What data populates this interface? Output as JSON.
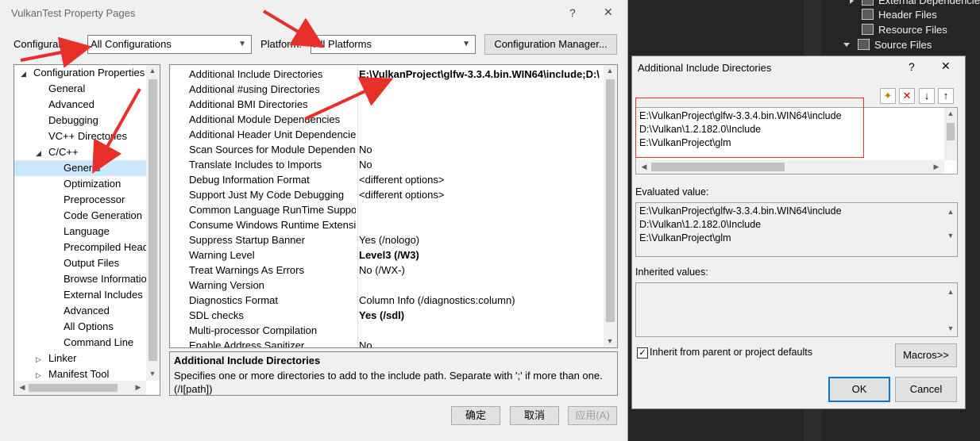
{
  "solution_explorer": {
    "items": [
      {
        "label": "External Dependencies"
      },
      {
        "label": "Header Files"
      },
      {
        "label": "Resource Files"
      },
      {
        "label": "Source Files"
      }
    ]
  },
  "dialog": {
    "title": "VulkanTest Property Pages",
    "help": "?",
    "close": "✕",
    "config_label": "Configuration:",
    "config_value": "All Configurations",
    "platform_label": "Platform:",
    "platform_value": "All Platforms",
    "config_manager": "Configuration Manager...",
    "tree": [
      {
        "label": "Configuration Properties",
        "exp": "open",
        "indent": 0
      },
      {
        "label": "General",
        "indent": 1
      },
      {
        "label": "Advanced",
        "indent": 1
      },
      {
        "label": "Debugging",
        "indent": 1
      },
      {
        "label": "VC++ Directories",
        "indent": 1
      },
      {
        "label": "C/C++",
        "exp": "open",
        "indent": 1
      },
      {
        "label": "General",
        "indent": 2,
        "selected": true
      },
      {
        "label": "Optimization",
        "indent": 2
      },
      {
        "label": "Preprocessor",
        "indent": 2
      },
      {
        "label": "Code Generation",
        "indent": 2
      },
      {
        "label": "Language",
        "indent": 2
      },
      {
        "label": "Precompiled Heade",
        "indent": 2
      },
      {
        "label": "Output Files",
        "indent": 2
      },
      {
        "label": "Browse Informatio",
        "indent": 2
      },
      {
        "label": "External Includes",
        "indent": 2
      },
      {
        "label": "Advanced",
        "indent": 2
      },
      {
        "label": "All Options",
        "indent": 2
      },
      {
        "label": "Command Line",
        "indent": 2
      },
      {
        "label": "Linker",
        "exp": "closed",
        "indent": 1
      },
      {
        "label": "Manifest Tool",
        "exp": "closed",
        "indent": 1
      }
    ],
    "props": [
      {
        "name": "Additional Include Directories",
        "value": "E:\\VulkanProject\\glfw-3.3.4.bin.WIN64\\include;D:\\",
        "bold": true
      },
      {
        "name": "Additional #using Directories",
        "value": ""
      },
      {
        "name": "Additional BMI Directories",
        "value": ""
      },
      {
        "name": "Additional Module Dependencies",
        "value": ""
      },
      {
        "name": "Additional Header Unit Dependencie",
        "value": ""
      },
      {
        "name": "Scan Sources for Module Dependenc",
        "value": "No"
      },
      {
        "name": "Translate Includes to Imports",
        "value": "No"
      },
      {
        "name": "Debug Information Format",
        "value": "<different options>"
      },
      {
        "name": "Support Just My Code Debugging",
        "value": "<different options>"
      },
      {
        "name": "Common Language RunTime Suppo",
        "value": ""
      },
      {
        "name": "Consume Windows Runtime Extensic",
        "value": ""
      },
      {
        "name": "Suppress Startup Banner",
        "value": "Yes (/nologo)"
      },
      {
        "name": "Warning Level",
        "value": "Level3 (/W3)",
        "bold": true
      },
      {
        "name": "Treat Warnings As Errors",
        "value": "No (/WX-)"
      },
      {
        "name": "Warning Version",
        "value": ""
      },
      {
        "name": "Diagnostics Format",
        "value": "Column Info (/diagnostics:column)"
      },
      {
        "name": "SDL checks",
        "value": "Yes (/sdl)",
        "bold": true
      },
      {
        "name": "Multi-processor Compilation",
        "value": ""
      },
      {
        "name": "Enable Address Sanitizer",
        "value": "No"
      }
    ],
    "desc_title": "Additional Include Directories",
    "desc_text": "Specifies one or more directories to add to the include path. Separate with ';' if more than one.     (/I[path])",
    "ok": "确定",
    "cancel": "取消",
    "apply": "应用(A)"
  },
  "inner": {
    "title": "Additional Include Directories",
    "help": "?",
    "close": "✕",
    "dirs": [
      "E:\\VulkanProject\\glfw-3.3.4.bin.WIN64\\include",
      "D:\\Vulkan\\1.2.182.0\\Include",
      "E:\\VulkanProject\\glm"
    ],
    "evaluated_label": "Evaluated value:",
    "evaluated": [
      "E:\\VulkanProject\\glfw-3.3.4.bin.WIN64\\include",
      "D:\\Vulkan\\1.2.182.0\\Include",
      "E:\\VulkanProject\\glm"
    ],
    "inherited_label": "Inherited values:",
    "inherit_checkbox": "Inherit from parent or project defaults",
    "macros": "Macros>>",
    "ok": "OK",
    "cancel": "Cancel"
  },
  "colors": {
    "annotation": "#e8302a",
    "selection": "#cce8ff"
  }
}
